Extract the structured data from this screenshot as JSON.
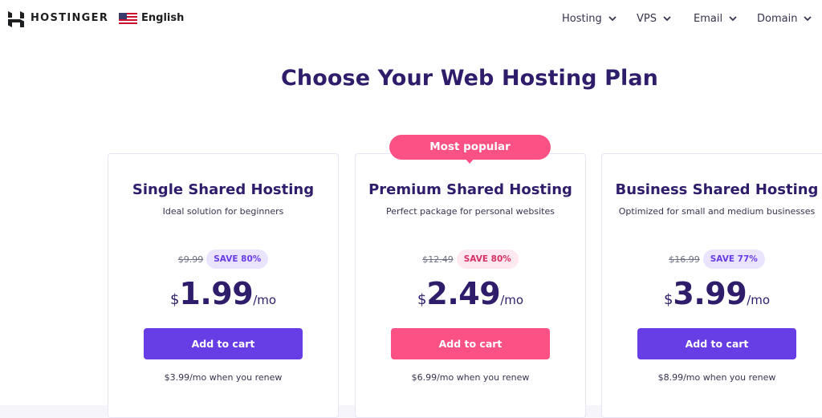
{
  "header": {
    "brand": "HOSTINGER",
    "language": "English",
    "nav": [
      {
        "label": "Hosting"
      },
      {
        "label": "VPS"
      },
      {
        "label": "Email"
      },
      {
        "label": "Domain"
      }
    ]
  },
  "main": {
    "title": "Choose Your Web Hosting Plan",
    "popular_label": "Most popular",
    "plans": [
      {
        "name": "Single Shared Hosting",
        "description": "Ideal solution for beginners",
        "old_price": "$9.99",
        "save": "SAVE 80%",
        "currency": "$",
        "price": "1.99",
        "per": "/mo",
        "button": "Add to cart",
        "renew": "$3.99/mo when you renew"
      },
      {
        "name": "Premium Shared Hosting",
        "description": "Perfect package for personal websites",
        "old_price": "$12.49",
        "save": "SAVE 80%",
        "currency": "$",
        "price": "2.49",
        "per": "/mo",
        "button": "Add to cart",
        "renew": "$6.99/mo when you renew"
      },
      {
        "name": "Business Shared Hosting",
        "description": "Optimized for small and medium businesses",
        "old_price": "$16.99",
        "save": "SAVE 77%",
        "currency": "$",
        "price": "3.99",
        "per": "/mo",
        "button": "Add to cart",
        "renew": "$8.99/mo when you renew"
      }
    ]
  },
  "colors": {
    "primary": "#673de6",
    "accent": "#fc5185",
    "title": "#2f1c6a",
    "save_purple_bg": "#ebe4ff",
    "save_pink_bg": "#ffe8ef"
  },
  "icons": {
    "logo": "hostinger-logo-icon",
    "flag": "us-flag-icon",
    "chevron": "chevron-down-icon"
  }
}
